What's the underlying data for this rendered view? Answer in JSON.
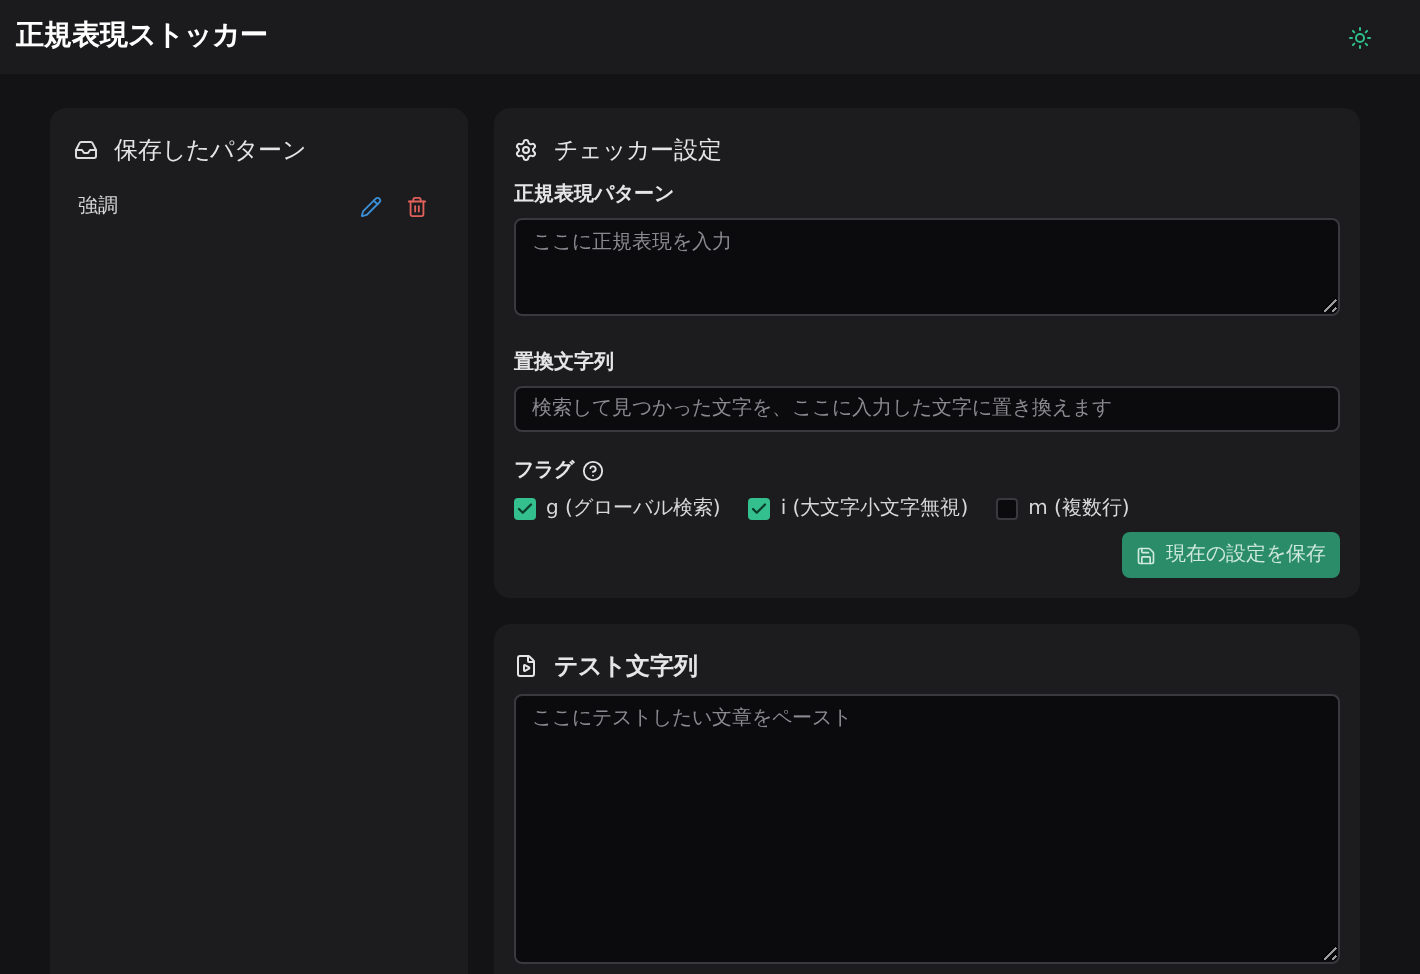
{
  "header": {
    "title": "正規表現ストッカー"
  },
  "saved_patterns": {
    "title": "保存したパターン",
    "items": [
      {
        "name": "強調"
      }
    ]
  },
  "checker": {
    "title": "チェッカー設定",
    "pattern_label": "正規表現パターン",
    "pattern_placeholder": "ここに正規表現を入力",
    "replace_label": "置換文字列",
    "replace_placeholder": "検索して見つかった文字を、ここに入力した文字に置き換えます",
    "flags_label": "フラグ",
    "flags": [
      {
        "label": "g (グローバル検索)",
        "checked": true
      },
      {
        "label": "i (大文字小文字無視)",
        "checked": true
      },
      {
        "label": "m (複数行)",
        "checked": false
      }
    ],
    "save_button": "現在の設定を保存"
  },
  "test": {
    "title": "テスト文字列",
    "placeholder": "ここにテストしたい文章をペースト"
  }
}
